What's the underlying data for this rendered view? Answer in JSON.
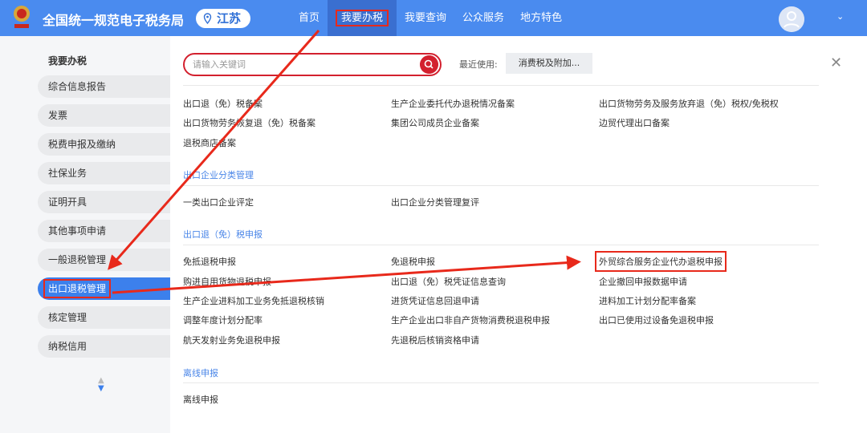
{
  "header": {
    "title": "全国统一规范电子税务局",
    "region": "江苏",
    "nav": [
      "首页",
      "我要办税",
      "我要查询",
      "公众服务",
      "地方特色"
    ],
    "active_nav": "我要办税"
  },
  "sidebar": {
    "title": "我要办税",
    "items": [
      "综合信息报告",
      "发票",
      "税费申报及缴纳",
      "社保业务",
      "证明开具",
      "其他事项申请",
      "一般退税管理",
      "出口退税管理",
      "核定管理",
      "纳税信用"
    ],
    "active": "出口退税管理"
  },
  "search": {
    "placeholder": "请输入关键词"
  },
  "recent": {
    "label": "最近使用:",
    "item": "消费税及附加..."
  },
  "sections": [
    {
      "title": "",
      "links": [
        "出口退（免）税备案",
        "生产企业委托代办退税情况备案",
        "出口货物劳务及服务放弃退（免）税权/免税权",
        "出口货物劳务恢复退（免）税备案",
        "集团公司成员企业备案",
        "边贸代理出口备案",
        "退税商店备案"
      ]
    },
    {
      "title": "出口企业分类管理",
      "links": [
        "一类出口企业评定",
        "出口企业分类管理复评"
      ]
    },
    {
      "title": "出口退（免）税申报",
      "links": [
        "免抵退税申报",
        "免退税申报",
        "外贸综合服务企业代办退税申报",
        "购进自用货物退税申报",
        "出口退（免）税凭证信息查询",
        "企业撤回申报数据申请",
        "生产企业进料加工业务免抵退税核销",
        "进货凭证信息回退申请",
        "进料加工计划分配率备案",
        "调整年度计划分配率",
        "生产企业出口非自产货物消费税退税申报",
        "出口已使用过设备免退税申报",
        "航天发射业务免退税申报",
        "先退税后核销资格申请"
      ]
    },
    {
      "title": "离线申报",
      "links": [
        "离线申报"
      ]
    }
  ],
  "highlighted": "外贸综合服务企业代办退税申报",
  "colors": {
    "header": "#4a8bef",
    "accent": "#3c80ec",
    "annotation": "#e8291b",
    "section": "#4a86e8"
  }
}
